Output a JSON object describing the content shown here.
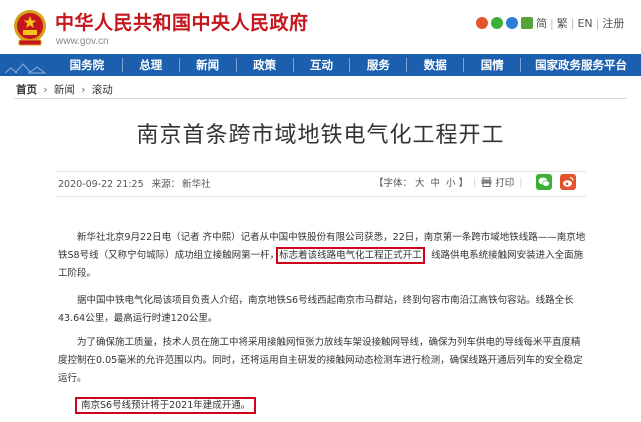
{
  "header": {
    "site_title": "中华人民共和国中央人民政府",
    "site_url": "www.gov.cn",
    "links": [
      "简",
      "繁",
      "EN",
      "注册"
    ]
  },
  "nav": {
    "items": [
      "国务院",
      "总理",
      "新闻",
      "政策",
      "互动",
      "服务",
      "数据",
      "国情",
      "国家政务服务平台"
    ]
  },
  "breadcrumb": {
    "items": [
      "首页",
      "新闻",
      "滚动"
    ]
  },
  "article": {
    "title": "南京首条跨市域地铁电气化工程开工",
    "date": "2020-09-22 21:25",
    "source_label": "来源：",
    "source": "新华社",
    "font_label": "【字体：",
    "font_sizes": [
      "大",
      "中",
      "小"
    ],
    "font_close": "】",
    "print_label": "打印",
    "p1_a": "新华社北京9月22日电（记者 齐中熙）记者从中国中铁股份有限公司获悉，22日，南京第一条跨市域地铁线路——南京地铁S8号线（又称宁句城际）成功组立接触网第一杆，",
    "p1_hl": "标志着该线路电气化工程正式开工",
    "p1_b": "，线路供电系统接触网安装进入全面施工阶段。",
    "p2": "据中国中铁电气化局该项目负责人介绍，南京地铁S6号线西起南京市马群站，终到句容市南沿江高铁句容站。线路全长43.64公里，最高运行时速120公里。",
    "p3": "为了确保施工质量，技术人员在施工中将采用接触网恒张力放线车架设接触网导线，确保为列车供电的导线每米平直度精度控制在0.05毫米的允许范围以内。同时，还将运用自主研发的接触网动态检测车进行检测，确保线路开通后列车的安全稳定运行。",
    "p4": "南京S6号线预计将于2021年建成开通。"
  },
  "colors": {
    "brand_red": "#c4161c",
    "nav_blue": "#1c5fae",
    "highlight_red": "#d0021b"
  }
}
